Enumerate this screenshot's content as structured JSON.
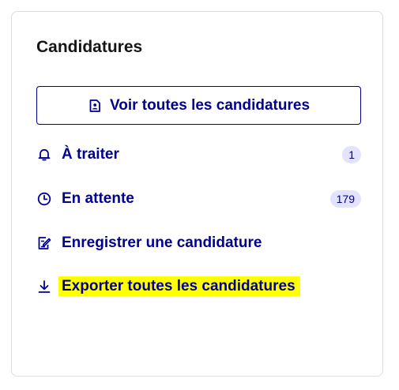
{
  "card": {
    "title": "Candidatures",
    "primary_button": {
      "label": "Voir toutes les candidatures",
      "icon": "document-user-icon"
    },
    "items": [
      {
        "label": "À traiter",
        "icon": "bell-icon",
        "badge": "1"
      },
      {
        "label": "En attente",
        "icon": "clock-icon",
        "badge": "179"
      },
      {
        "label": "Enregistrer une candidature",
        "icon": "edit-document-icon"
      },
      {
        "label": "Exporter toutes les candidatures",
        "icon": "download-icon",
        "highlighted": true
      }
    ]
  },
  "colors": {
    "primary": "#000091",
    "badge_background": "#e3e3fd",
    "highlight": "#ffff00",
    "title": "#161616",
    "border": "#dddddd"
  }
}
